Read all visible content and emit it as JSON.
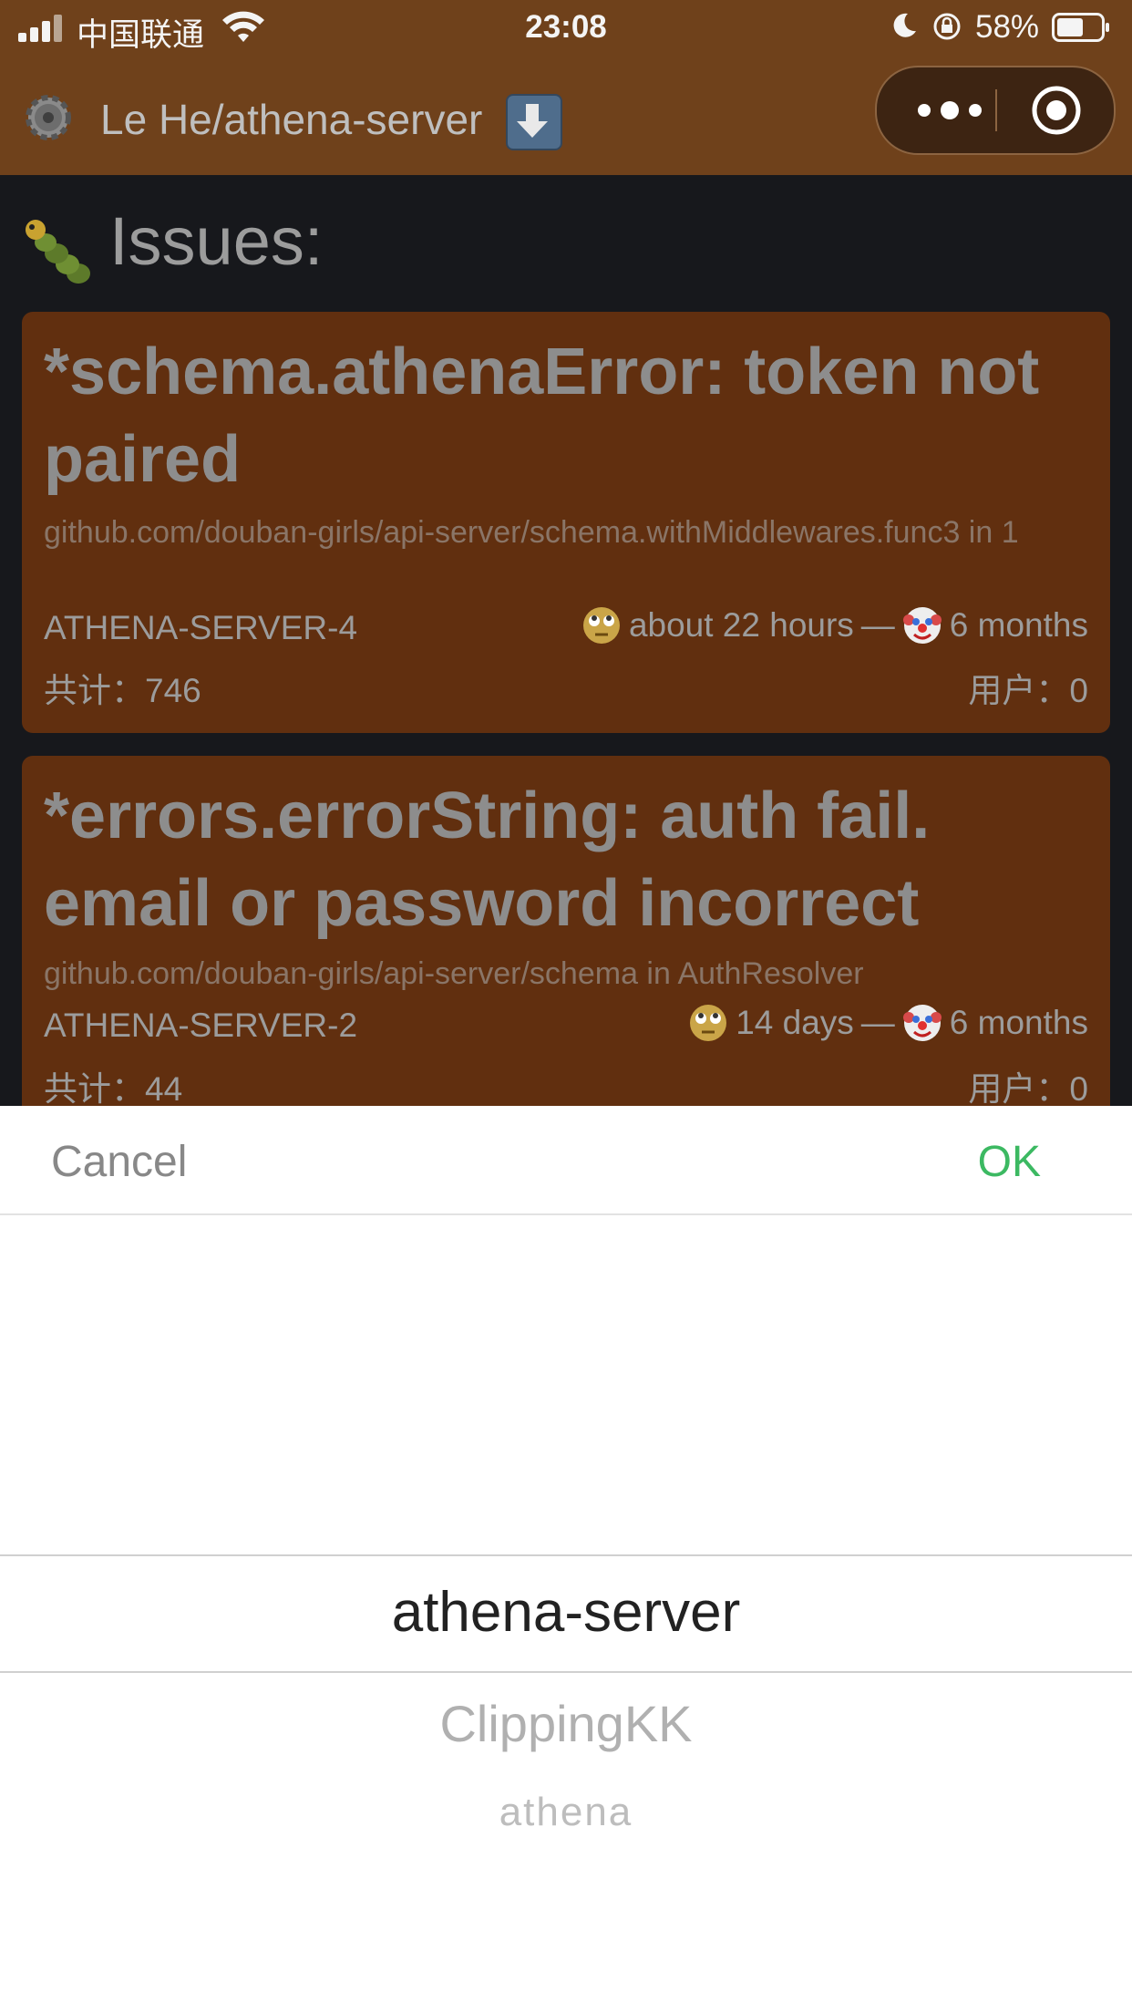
{
  "status_bar": {
    "carrier": "中国联通",
    "time": "23:08",
    "battery": "58%"
  },
  "nav": {
    "title": "Le He/athena-server",
    "icons": [
      "gear-icon",
      "down-arrow-icon",
      "more-icon",
      "target-icon"
    ]
  },
  "issues": {
    "title": "Issues:",
    "icon": "caterpillar-icon",
    "cards": [
      {
        "title": "*schema.athenaError: token not paired",
        "subtitle": "github.com/douban-girls/api-server/schema.withMiddlewares.func3 in 1",
        "id": "ATHENA-SERVER-4",
        "last_seen": "about 22 hours",
        "separator": "—",
        "first_seen": "6 months",
        "total": "共计：746",
        "users": "用户：0"
      },
      {
        "title": "*errors.errorString: auth fail. email or password incorrect",
        "subtitle": "github.com/douban-girls/api-server/schema in AuthResolver",
        "id": "ATHENA-SERVER-2",
        "last_seen": "14 days",
        "separator": "—",
        "first_seen": "6 months",
        "total": "共计：44",
        "users": "用户：0"
      }
    ]
  },
  "picker": {
    "cancel_label": "Cancel",
    "ok_label": "OK",
    "options": [
      "athena-server",
      "ClippingKK",
      "athena"
    ],
    "selected": "athena-server",
    "ok_color": "#3cb962"
  }
}
